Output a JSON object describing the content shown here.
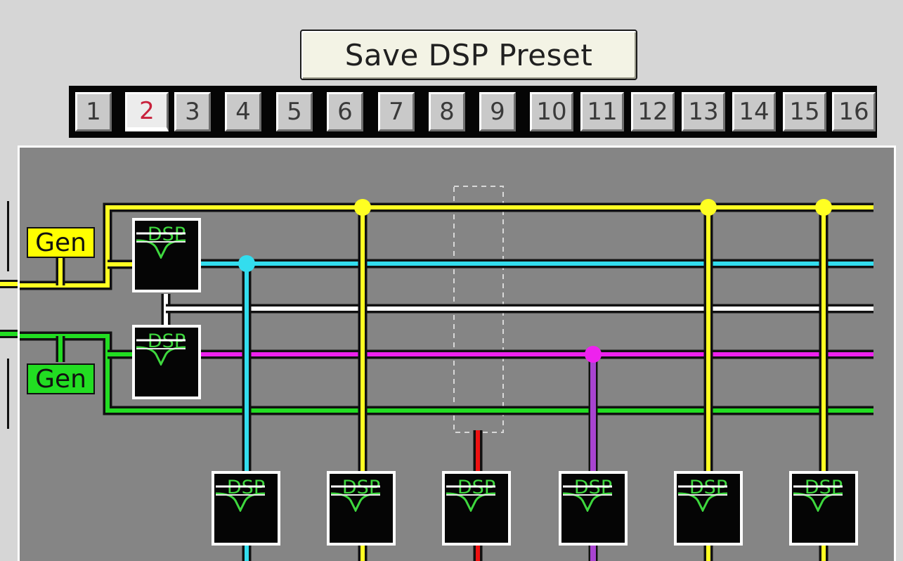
{
  "toolbar": {
    "save_label": "Save DSP Preset"
  },
  "presets": {
    "active": 2,
    "items": [
      "1",
      "2",
      "3",
      "4",
      "5",
      "6",
      "7",
      "8",
      "9",
      "10",
      "11",
      "12",
      "13",
      "14",
      "15",
      "16"
    ]
  },
  "generators": [
    {
      "label": "Gen",
      "color": "#ffff00"
    },
    {
      "label": "Gen",
      "color": "#22dd22"
    }
  ],
  "dsp_label": "DSP",
  "colors": {
    "yellow": "#ffff22",
    "cyan": "#33ddee",
    "white": "#ffffff",
    "magenta": "#ee22ee",
    "green": "#22dd22",
    "purple": "#a844d0",
    "red": "#ee1111",
    "dsp_text": "#3ed83e",
    "background": "#858585"
  }
}
